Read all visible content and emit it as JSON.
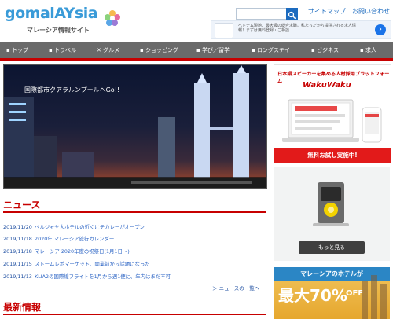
{
  "header": {
    "logo_text": "gomalAYsia",
    "logo_sub": "マレーシア情報サイト",
    "top_links": [
      "サイトマップ",
      "お問い合わせ"
    ],
    "ad_text": "ベトナム現地、最大級の総合求職。私たちだから提供される求人情報！まずは無料登録・ご相談"
  },
  "nav": {
    "items": [
      "トップ",
      "トラベル",
      "グルメ",
      "ショッピング",
      "学び／留学",
      "ロングステイ",
      "ビジネス",
      "求人"
    ]
  },
  "hero": {
    "caption": "国際都市クアラルンプールへGo!!"
  },
  "news": {
    "title": "ニュース",
    "items": [
      {
        "date": "2019/11/20",
        "text": "ベルジャヤ大ホテルの近くにテカレーがオープン"
      },
      {
        "date": "2019/11/18",
        "text": "2020年 マレーシア旅行カレンダー"
      },
      {
        "date": "2019/11/18",
        "text": "マレーシア 2020年度の祝祭日(1月1日〜)"
      },
      {
        "date": "2019/11/15",
        "text": "ストームレポマーケット、開業前から話題になった"
      },
      {
        "date": "2019/11/13",
        "text": "KLIA2の国際線フライトを1月から週1便に、年内はまだ不可"
      }
    ],
    "more": "＞ ニュースの一覧へ"
  },
  "latest": {
    "title": "最新情報"
  },
  "sidebar": {
    "ad1": {
      "title": "日本語スピーカーを集める人材採用プラットフォーム",
      "brand": "WakuWaku",
      "cta": "無料お試し実施中!"
    },
    "ad2": {
      "button": "もっと見る"
    },
    "ad3": {
      "top": "マレーシアのホテルが",
      "big": "最大70%",
      "small": "OFF"
    }
  },
  "colors": {
    "accent_red": "#c70000",
    "nav_gray": "#6a6a6a",
    "link_blue": "#2a63c4"
  }
}
